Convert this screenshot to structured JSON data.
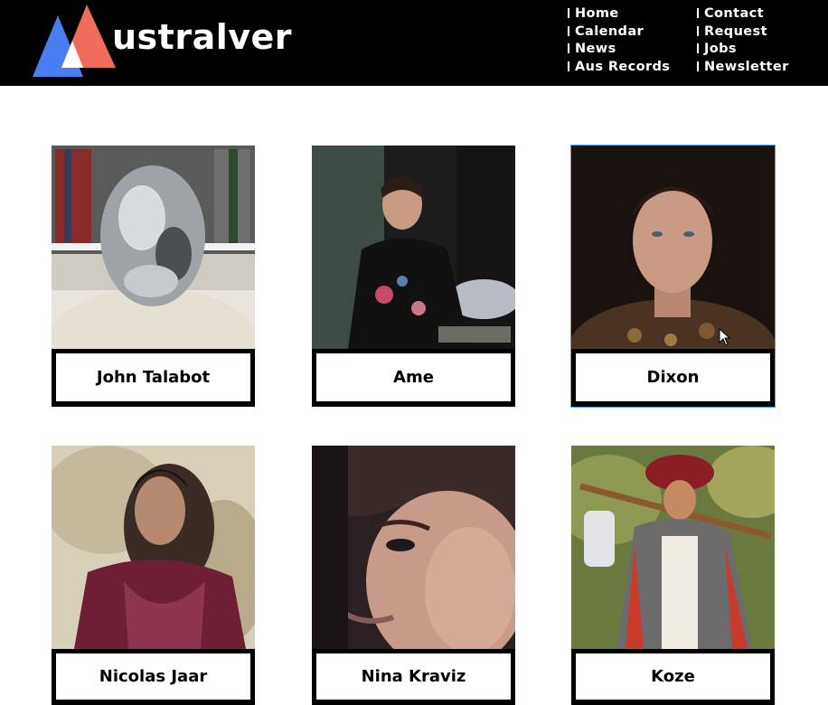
{
  "header": {
    "logo_text": "ustralver",
    "nav": {
      "column1": [
        "Home",
        "Calendar",
        "News",
        "Aus Records"
      ],
      "column2": [
        "Contact",
        "Request",
        "Jobs",
        "Newsletter"
      ]
    }
  },
  "artists": [
    {
      "name": "John Talabot"
    },
    {
      "name": "Ame"
    },
    {
      "name": "Dixon"
    },
    {
      "name": "Nicolas Jaar"
    },
    {
      "name": "Nina Kraviz"
    },
    {
      "name": "Koze"
    }
  ],
  "colors": {
    "header_bg": "#000000",
    "logo_blue": "#4a7df2",
    "logo_red": "#ef6b5a",
    "selection_outline": "#3aa6e8"
  }
}
